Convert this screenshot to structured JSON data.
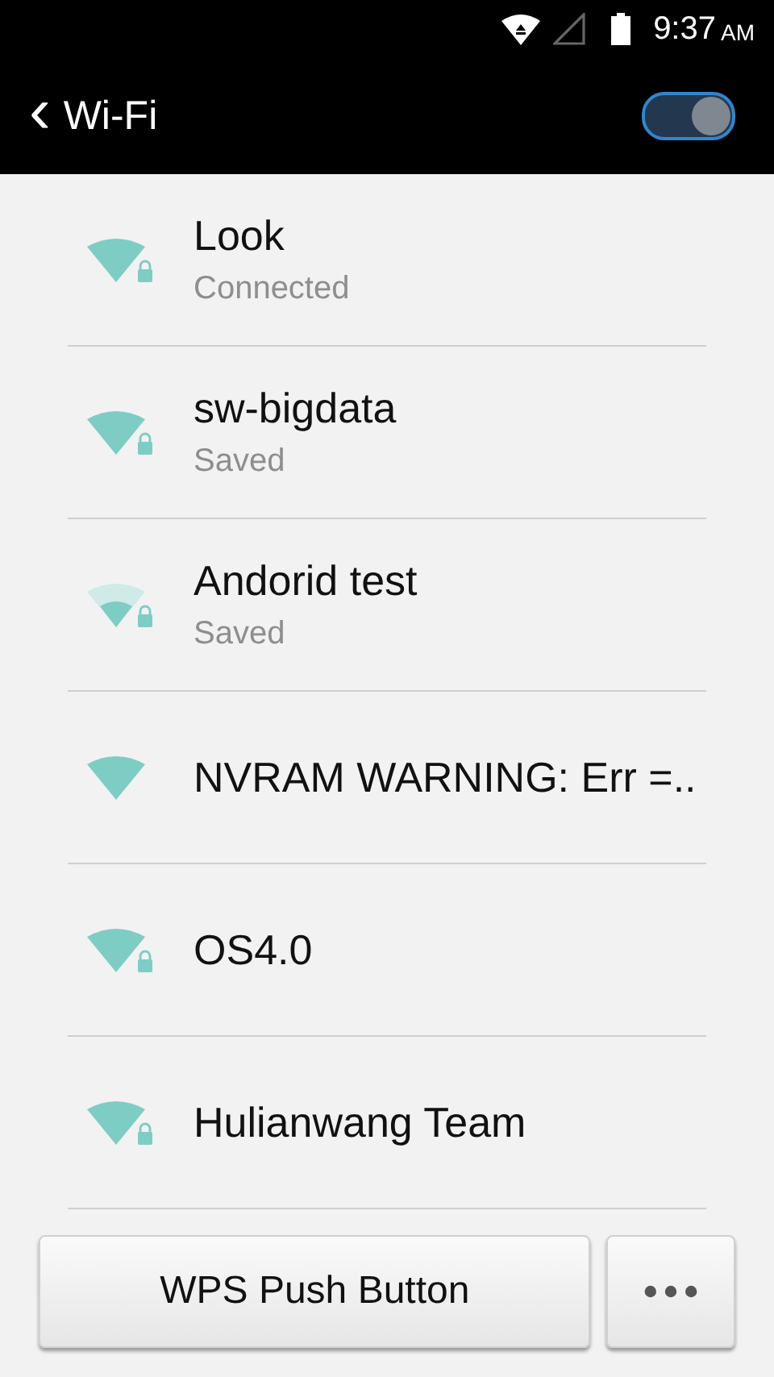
{
  "status_bar": {
    "time": "9:37",
    "meridiem": "AM"
  },
  "header": {
    "back": "‹",
    "title": "Wi-Fi",
    "wifi_on": true
  },
  "networks": [
    {
      "name": "Look",
      "status": "Connected",
      "secured": true,
      "kind": "strong"
    },
    {
      "name": "sw-bigdata",
      "status": "Saved",
      "secured": true,
      "kind": "strong"
    },
    {
      "name": "Andorid test",
      "status": "Saved",
      "secured": true,
      "kind": "weak"
    },
    {
      "name": "NVRAM WARNING: Err =..",
      "secured": false,
      "kind": "strong"
    },
    {
      "name": "OS4.0",
      "secured": true,
      "kind": "strong"
    },
    {
      "name": "Hulianwang Team",
      "secured": true,
      "kind": "strong"
    }
  ],
  "buttons": {
    "wps": "WPS Push Button"
  }
}
